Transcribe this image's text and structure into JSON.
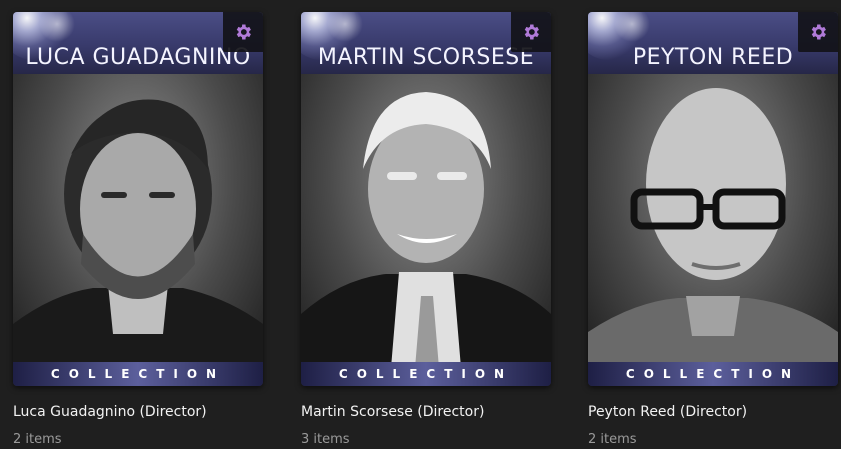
{
  "collections": [
    {
      "banner_name": "LUCA GUADAGNINO",
      "collection_label": "COLLECTION",
      "title": "Luca Guadagnino (Director)",
      "count": "2 items",
      "settings_icon": "gear-icon"
    },
    {
      "banner_name": "MARTIN SCORSESE",
      "collection_label": "COLLECTION",
      "title": "Martin Scorsese (Director)",
      "count": "3 items",
      "settings_icon": "gear-icon"
    },
    {
      "banner_name": "PEYTON REED",
      "collection_label": "COLLECTION",
      "title": "Peyton Reed (Director)",
      "count": "2 items",
      "settings_icon": "gear-icon"
    }
  ],
  "colors": {
    "background": "#1f1f1f",
    "banner": "#383a6b",
    "gear_accent": "#b07ad8"
  }
}
